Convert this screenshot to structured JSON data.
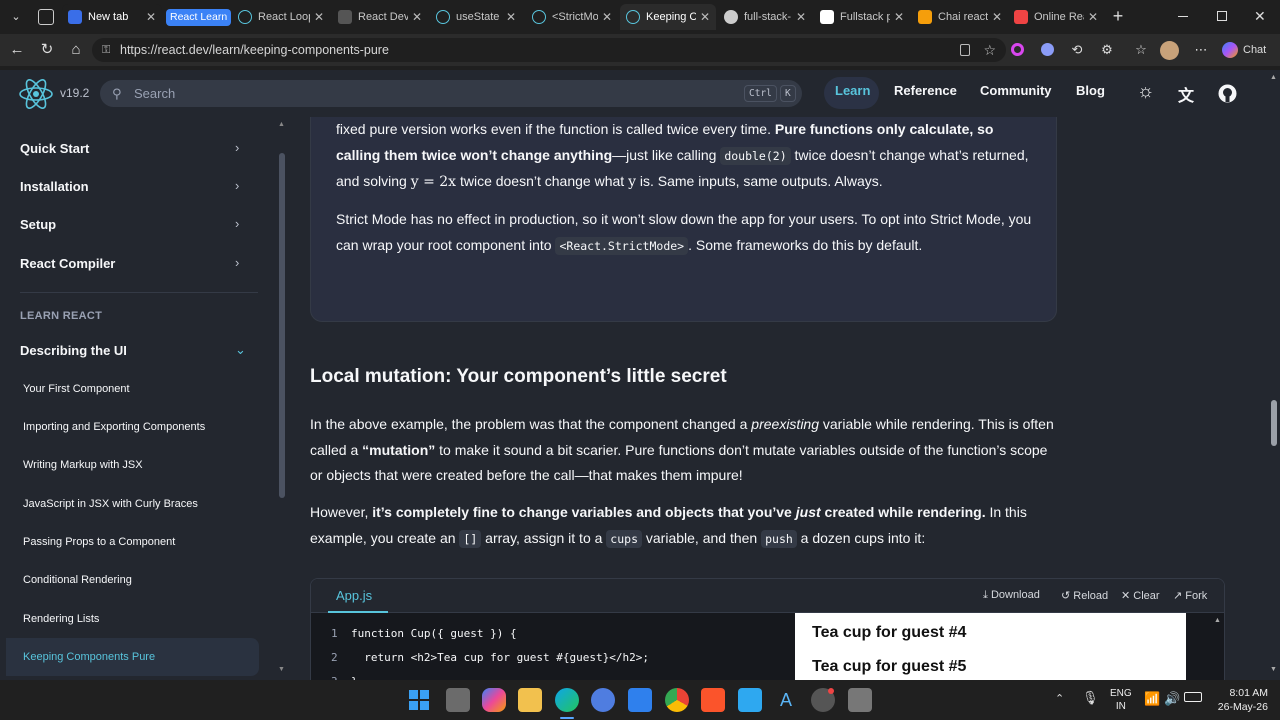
{
  "browser": {
    "tabs": [
      {
        "label": "New tab",
        "color": "#3a6ee8"
      },
      {
        "label": "React Learn",
        "color": "#3b82f6",
        "group": true
      },
      {
        "label": "React Loop",
        "color": "#58c4dc"
      },
      {
        "label": "React Dev",
        "color": "#888888"
      },
      {
        "label": "useState –",
        "color": "#58c4dc"
      },
      {
        "label": "<StrictMo",
        "color": "#58c4dc"
      },
      {
        "label": "Keeping Co",
        "color": "#58c4dc"
      },
      {
        "label": "full-stack-",
        "color": "#cccccc"
      },
      {
        "label": "Fullstack p",
        "color": "#ffffff"
      },
      {
        "label": "Chai react",
        "color": "#f59e0b"
      },
      {
        "label": "Online Rea",
        "color": "#ef4444"
      }
    ],
    "url": "https://react.dev/learn/keeping-components-pure",
    "chat_label": "Chat"
  },
  "site": {
    "version": "v19.2",
    "search_placeholder": "Search",
    "kbd_ctrl": "Ctrl",
    "kbd_k": "K",
    "nav": [
      "Learn",
      "Reference",
      "Community",
      "Blog"
    ]
  },
  "sidebar": {
    "top_items": [
      "Quick Start",
      "Installation",
      "Setup",
      "React Compiler"
    ],
    "section_label": "LEARN REACT",
    "section_title": "Describing the UI",
    "items": [
      "Your First Component",
      "Importing and Exporting Components",
      "Writing Markup with JSX",
      "JavaScript in JSX with Curly Braces",
      "Passing Props to a Component",
      "Conditional Rendering",
      "Rendering Lists",
      "Keeping Components Pure"
    ]
  },
  "content": {
    "callout_p1": {
      "a": "fixed pure version works even if the function is called twice every time. ",
      "b": "Pure functions only calculate, so calling them twice won’t change anything",
      "c": "—just like calling ",
      "code": "double(2)",
      "d": " twice doesn’t change what’s returned, and solving ",
      "math1": "y = 2x",
      "e": " twice doesn’t change what ",
      "math2": "y",
      "f": " is. Same inputs, same outputs. Always."
    },
    "callout_p2": {
      "a": "Strict Mode has no effect in production, so it won’t slow down the app for your users. To opt into Strict Mode, you can wrap your root component into ",
      "code": "<React.StrictMode>",
      "b": ". Some frameworks do this by default."
    },
    "heading": "Local mutation: Your component’s little secret",
    "p1": {
      "a": "In the above example, the problem was that the component changed a ",
      "em": "preexisting",
      "b": " variable while rendering. This is often called a ",
      "strong": "“mutation”",
      "c": " to make it sound a bit scarier. Pure functions don’t mutate variables outside of the function’s scope or objects that were created before the call—that makes them impure!"
    },
    "p2": {
      "a": "However, ",
      "strong1": "it’s completely fine to change variables and objects that you’ve ",
      "em": "just",
      "strong2": " created while rendering.",
      "b": " In this example, you create an ",
      "code1": "[]",
      "c": " array, assign it to a ",
      "code2": "cups",
      "d": " variable, and then ",
      "code3": "push",
      "e": " a dozen cups into it:"
    }
  },
  "sandbox": {
    "file_tab": "App.js",
    "actions": [
      "Download",
      "Reload",
      "Clear",
      "Fork"
    ],
    "lines": [
      {
        "num": "1",
        "code": "function Cup({ guest }) {"
      },
      {
        "num": "2",
        "code": "  return <h2>Tea cup for guest #{guest}</h2>;"
      },
      {
        "num": "3",
        "code": "}"
      }
    ],
    "preview": [
      "Tea cup for guest #4",
      "Tea cup for guest #5"
    ]
  },
  "taskbar": {
    "lang_top": "ENG",
    "lang_bottom": "IN",
    "time": "8:01 AM",
    "date": "26-May-26"
  }
}
